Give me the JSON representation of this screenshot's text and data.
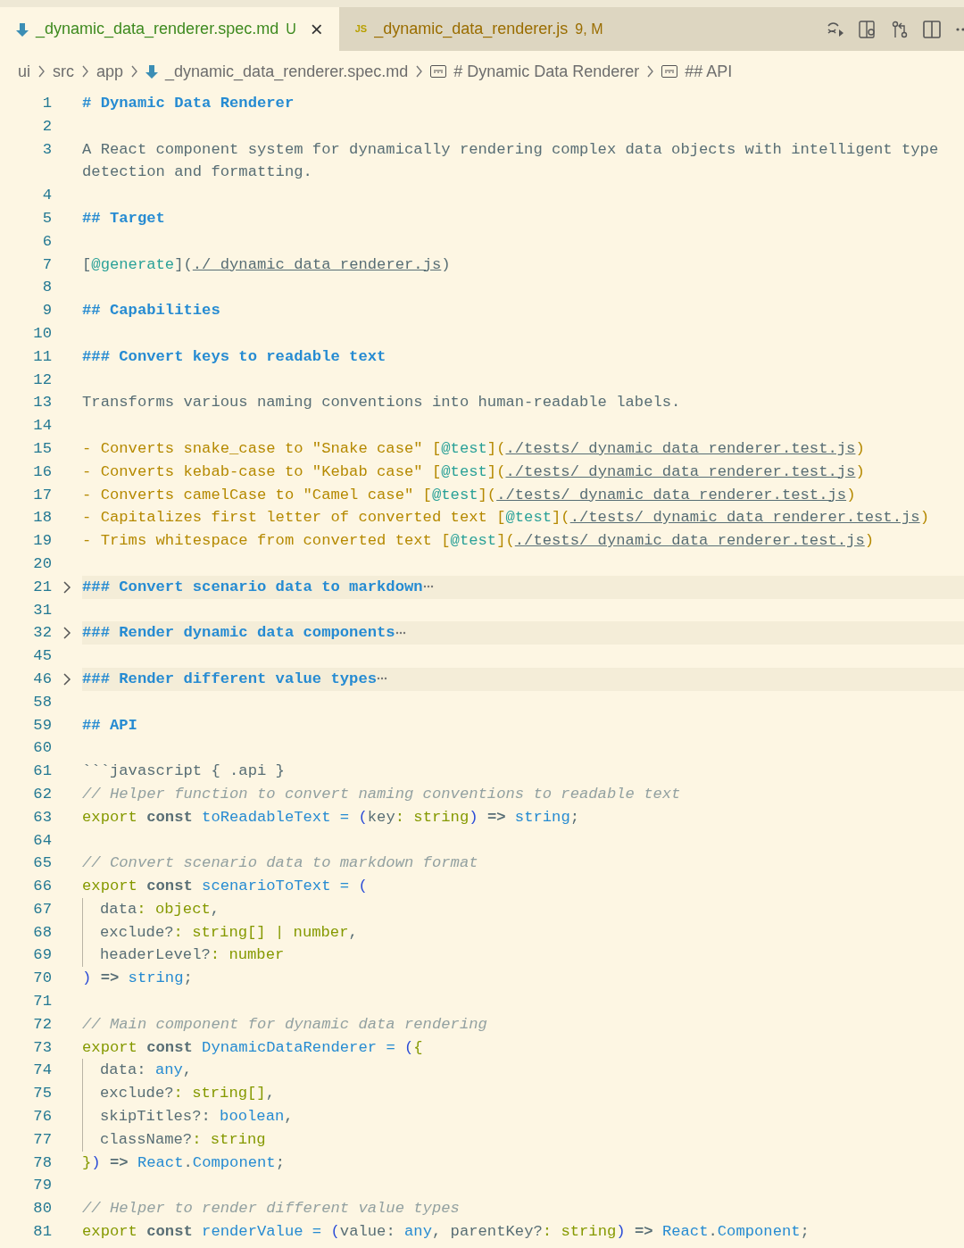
{
  "tabs": [
    {
      "kind": "markdown",
      "label": "_dynamic_data_renderer.spec.md",
      "color": "#3e8a1f",
      "status": "U",
      "close": "×",
      "selected": true
    },
    {
      "kind": "js",
      "icon_text": "JS",
      "label": "_dynamic_data_renderer.js",
      "color": "#9a6d00",
      "status": "9, M",
      "selected": false
    }
  ],
  "breadcrumbs": [
    {
      "kind": "plain",
      "text": "ui"
    },
    {
      "kind": "plain",
      "text": "src"
    },
    {
      "kind": "plain",
      "text": "app"
    },
    {
      "kind": "markdown",
      "text": "_dynamic_data_renderer.spec.md"
    },
    {
      "kind": "symbol",
      "text": "# Dynamic Data Renderer"
    },
    {
      "kind": "symbol",
      "text": "## API"
    }
  ],
  "lines": [
    {
      "number": "1",
      "tokens": [
        {
          "kind": "h",
          "text": "# Dynamic Data Renderer"
        }
      ]
    },
    {
      "number": "2"
    },
    {
      "number": "3",
      "tokens": [
        {
          "kind": "p",
          "text": "A React component system for dynamically rendering complex data objects with intelligent type detection and formatting."
        }
      ]
    },
    {
      "number": "4"
    },
    {
      "number": "5",
      "tokens": [
        {
          "kind": "h",
          "text": "## Target"
        }
      ]
    },
    {
      "number": "6"
    },
    {
      "number": "7",
      "tokens": [
        {
          "kind": "p",
          "text": "["
        },
        {
          "kind": "label",
          "text": "@generate"
        },
        {
          "kind": "p",
          "text": "]("
        },
        {
          "kind": "url",
          "text": "./_dynamic_data_renderer.js"
        },
        {
          "kind": "p",
          "text": ")"
        }
      ]
    },
    {
      "number": "8"
    },
    {
      "number": "9",
      "tokens": [
        {
          "kind": "h",
          "text": "## Capabilities"
        }
      ]
    },
    {
      "number": "10"
    },
    {
      "number": "11",
      "tokens": [
        {
          "kind": "h",
          "text": "### Convert keys to readable text"
        }
      ]
    },
    {
      "number": "12"
    },
    {
      "number": "13",
      "tokens": [
        {
          "kind": "p",
          "text": "Transforms various naming conventions into human-readable labels."
        }
      ]
    },
    {
      "number": "14"
    },
    {
      "number": "15",
      "tokens": [
        {
          "kind": "list",
          "text": "- Converts snake_case to \"Snake case\" ["
        },
        {
          "kind": "label",
          "text": "@test"
        },
        {
          "kind": "list",
          "text": "]("
        },
        {
          "kind": "url",
          "text": "./tests/_dynamic_data_renderer.test.js"
        },
        {
          "kind": "list",
          "text": ")"
        }
      ]
    },
    {
      "number": "16",
      "tokens": [
        {
          "kind": "list",
          "text": "- Converts kebab-case to \"Kebab case\" ["
        },
        {
          "kind": "label",
          "text": "@test"
        },
        {
          "kind": "list",
          "text": "]("
        },
        {
          "kind": "url",
          "text": "./tests/_dynamic_data_renderer.test.js"
        },
        {
          "kind": "list",
          "text": ")"
        }
      ]
    },
    {
      "number": "17",
      "tokens": [
        {
          "kind": "list",
          "text": "- Converts camelCase to \"Camel case\" ["
        },
        {
          "kind": "label",
          "text": "@test"
        },
        {
          "kind": "list",
          "text": "]("
        },
        {
          "kind": "url",
          "text": "./tests/_dynamic_data_renderer.test.js"
        },
        {
          "kind": "list",
          "text": ")"
        }
      ]
    },
    {
      "number": "18",
      "tokens": [
        {
          "kind": "list",
          "text": "- Capitalizes first letter of converted text ["
        },
        {
          "kind": "label",
          "text": "@test"
        },
        {
          "kind": "list",
          "text": "]("
        },
        {
          "kind": "url",
          "text": "./tests/_dynamic_data_renderer.test.js"
        },
        {
          "kind": "list",
          "text": ")"
        }
      ]
    },
    {
      "number": "19",
      "tokens": [
        {
          "kind": "list",
          "text": "- Trims whitespace from converted text ["
        },
        {
          "kind": "label",
          "text": "@test"
        },
        {
          "kind": "list",
          "text": "]("
        },
        {
          "kind": "url",
          "text": "./tests/_dynamic_data_renderer.test.js"
        },
        {
          "kind": "list",
          "text": ")"
        }
      ]
    },
    {
      "number": "20"
    },
    {
      "number": "21",
      "folded": true,
      "tokens": [
        {
          "kind": "h",
          "text": "### Convert scenario data to markdown"
        }
      ]
    },
    {
      "number": "31"
    },
    {
      "number": "32",
      "folded": true,
      "tokens": [
        {
          "kind": "h",
          "text": "### Render dynamic data components"
        }
      ]
    },
    {
      "number": "45"
    },
    {
      "number": "46",
      "folded": true,
      "tokens": [
        {
          "kind": "h",
          "text": "### Render different value types"
        }
      ]
    },
    {
      "number": "58"
    },
    {
      "number": "59",
      "tokens": [
        {
          "kind": "h",
          "text": "## API"
        }
      ]
    },
    {
      "number": "60"
    },
    {
      "number": "61",
      "tokens": [
        {
          "kind": "p",
          "text": "```javascript { .api }"
        }
      ]
    },
    {
      "number": "62",
      "tokens": [
        {
          "kind": "comment",
          "text": "// Helper function to convert naming conventions to readable text"
        }
      ]
    },
    {
      "number": "63",
      "tokens": [
        {
          "kind": "kw",
          "text": "export "
        },
        {
          "kind": "bold",
          "text": "const "
        },
        {
          "kind": "fn",
          "text": "toReadableText = "
        },
        {
          "kind": "paren",
          "text": "("
        },
        {
          "kind": "p",
          "text": "key"
        },
        {
          "kind": "type",
          "text": ": string"
        },
        {
          "kind": "paren",
          "text": ")"
        },
        {
          "kind": "bold",
          "text": " => "
        },
        {
          "kind": "fn",
          "text": "string"
        },
        {
          "kind": "p",
          "text": ";"
        }
      ]
    },
    {
      "number": "64"
    },
    {
      "number": "65",
      "tokens": [
        {
          "kind": "comment",
          "text": "// Convert scenario data to markdown format"
        }
      ]
    },
    {
      "number": "66",
      "tokens": [
        {
          "kind": "kw",
          "text": "export "
        },
        {
          "kind": "bold",
          "text": "const "
        },
        {
          "kind": "fn",
          "text": "scenarioToText = "
        },
        {
          "kind": "paren",
          "text": "("
        }
      ]
    },
    {
      "number": "67",
      "guide": true,
      "tokens": [
        {
          "kind": "p",
          "text": "data"
        },
        {
          "kind": "type",
          "text": ": object"
        },
        {
          "kind": "p",
          "text": ","
        }
      ]
    },
    {
      "number": "68",
      "guide": true,
      "tokens": [
        {
          "kind": "p",
          "text": "exclude?"
        },
        {
          "kind": "type",
          "text": ": string[] | number"
        },
        {
          "kind": "p",
          "text": ","
        }
      ]
    },
    {
      "number": "69",
      "guide": true,
      "tokens": [
        {
          "kind": "p",
          "text": "headerLevel?"
        },
        {
          "kind": "type",
          "text": ": number"
        }
      ]
    },
    {
      "number": "70",
      "tokens": [
        {
          "kind": "paren",
          "text": ")"
        },
        {
          "kind": "bold",
          "text": " => "
        },
        {
          "kind": "fn",
          "text": "string"
        },
        {
          "kind": "p",
          "text": ";"
        }
      ]
    },
    {
      "number": "71"
    },
    {
      "number": "72",
      "tokens": [
        {
          "kind": "comment",
          "text": "// Main component for dynamic data rendering"
        }
      ]
    },
    {
      "number": "73",
      "tokens": [
        {
          "kind": "kw",
          "text": "export "
        },
        {
          "kind": "bold",
          "text": "const "
        },
        {
          "kind": "fn",
          "text": "DynamicDataRenderer = "
        },
        {
          "kind": "paren",
          "text": "("
        },
        {
          "kind": "type",
          "text": "{"
        }
      ]
    },
    {
      "number": "74",
      "guide": true,
      "tokens": [
        {
          "kind": "p",
          "text": "data: "
        },
        {
          "kind": "fn",
          "text": "any"
        },
        {
          "kind": "p",
          "text": ","
        }
      ]
    },
    {
      "number": "75",
      "guide": true,
      "tokens": [
        {
          "kind": "p",
          "text": "exclude?"
        },
        {
          "kind": "type",
          "text": ": string[]"
        },
        {
          "kind": "p",
          "text": ","
        }
      ]
    },
    {
      "number": "76",
      "guide": true,
      "tokens": [
        {
          "kind": "p",
          "text": "skipTitles?: "
        },
        {
          "kind": "fn",
          "text": "boolean"
        },
        {
          "kind": "p",
          "text": ","
        }
      ]
    },
    {
      "number": "77",
      "guide": true,
      "tokens": [
        {
          "kind": "p",
          "text": "className?"
        },
        {
          "kind": "type",
          "text": ": string"
        }
      ]
    },
    {
      "number": "78",
      "tokens": [
        {
          "kind": "type",
          "text": "}"
        },
        {
          "kind": "paren",
          "text": ")"
        },
        {
          "kind": "bold",
          "text": " => "
        },
        {
          "kind": "fn",
          "text": "React"
        },
        {
          "kind": "p",
          "text": "."
        },
        {
          "kind": "fn",
          "text": "Component"
        },
        {
          "kind": "p",
          "text": ";"
        }
      ]
    },
    {
      "number": "79"
    },
    {
      "number": "80",
      "tokens": [
        {
          "kind": "comment",
          "text": "// Helper to render different value types"
        }
      ]
    },
    {
      "number": "81",
      "tokens": [
        {
          "kind": "kw",
          "text": "export "
        },
        {
          "kind": "bold",
          "text": "const "
        },
        {
          "kind": "fn",
          "text": "renderValue = "
        },
        {
          "kind": "paren",
          "text": "("
        },
        {
          "kind": "p",
          "text": "value: "
        },
        {
          "kind": "fn",
          "text": "any"
        },
        {
          "kind": "p",
          "text": ", parentKey?"
        },
        {
          "kind": "type",
          "text": ": string"
        },
        {
          "kind": "paren",
          "text": ")"
        },
        {
          "kind": "bold",
          "text": " => "
        },
        {
          "kind": "fn",
          "text": "React"
        },
        {
          "kind": "p",
          "text": "."
        },
        {
          "kind": "fn",
          "text": "Component"
        },
        {
          "kind": "p",
          "text": ";"
        }
      ]
    }
  ]
}
